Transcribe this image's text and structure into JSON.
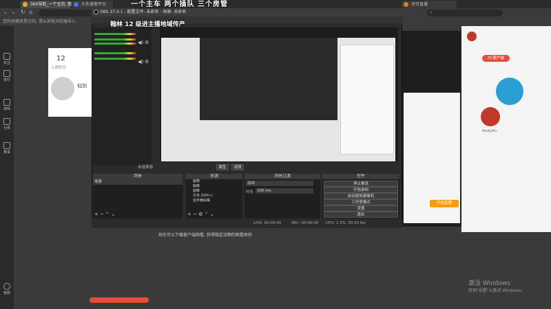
{
  "browser": {
    "tabs": [
      {
        "label": "360导航_一个主页, 整个世界"
      },
      {
        "label": "头条搜索平台"
      },
      {
        "label": "虎牙直播"
      },
      {
        "label": "OBS"
      }
    ],
    "url": "",
    "bookmarks_text": "您的收藏夹是空的, 请从其他浏览器导入"
  },
  "overlay": {
    "banner": "一个主车 两个插队 三个房管",
    "title": "翰林 12 级进主播地域传产"
  },
  "sidebar": {
    "items": [
      {
        "label": "关注"
      },
      {
        "label": "排行"
      },
      {
        "label": "游戏"
      },
      {
        "label": "分类"
      },
      {
        "label": "赛事"
      },
      {
        "label": "客服"
      }
    ]
  },
  "page": {
    "stat_value": "12",
    "stat_label": "上周积分",
    "streamer_name": "仙剑",
    "right_panel": {
      "pc_client": "PC客户端",
      "user_name": "AndyAn",
      "go_live": "开始直播"
    },
    "bottom_text": "抢先可以下载客户端观看, 获得稳定流畅的观看体验"
  },
  "obs": {
    "title": "OBS 27.0.1 - 配置文件: 未命名 - 场景: 未命名",
    "docks": {
      "scenes": "场景",
      "sources": "来源",
      "mixer_header": "音频混音器",
      "transitions": "场景过渡",
      "controls": "控件"
    },
    "scenes_list": [
      "场景"
    ],
    "sources_list": [
      "图像",
      "图像",
      "图像",
      "文本 (GDI+)",
      "显示器采集"
    ],
    "transition": {
      "type": "淡出",
      "duration_label": "时长",
      "duration": "300 ms"
    },
    "controls": [
      "停止推流",
      "开始录制",
      "启动虚拟摄像机",
      "工作室模式",
      "设置",
      "退出"
    ],
    "preview_label": "未选择源",
    "preview_buttons": [
      "属性",
      "滤镜"
    ],
    "status": {
      "live": "LIVE: 00:00:00",
      "rec": "REC: 00:00:00",
      "cpu": "CPU: 1.3%, 30.00 fps"
    }
  },
  "windows": {
    "activate_title": "激活 Windows",
    "activate_sub": "转到\"设置\"以激活 Windows。"
  },
  "colors": {
    "accent_orange": "#f39c12",
    "live_red": "#e74c3c",
    "obs_bg": "#2b2b2b"
  }
}
